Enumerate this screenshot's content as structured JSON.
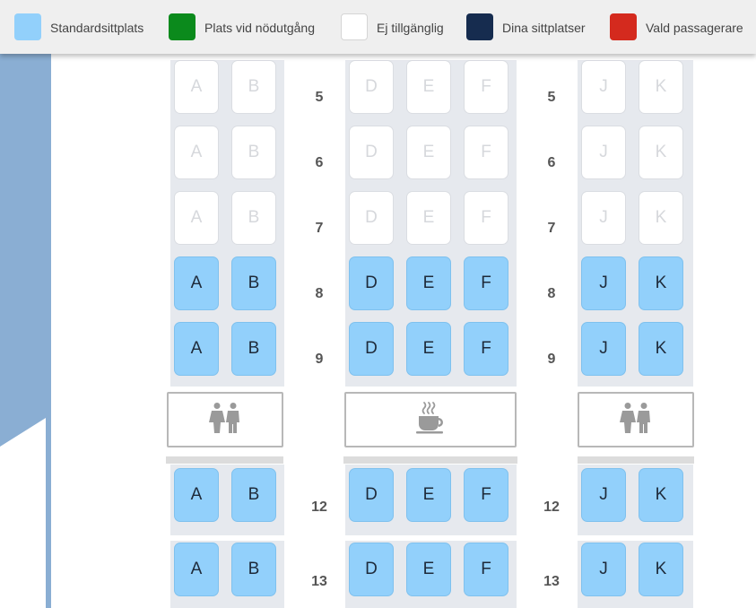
{
  "legend": [
    {
      "name": "legend-standard",
      "label": "Standardsittplats",
      "color": "#92d0fb"
    },
    {
      "name": "legend-emergency",
      "label": "Plats vid nödutgång",
      "color": "#0b8a1c"
    },
    {
      "name": "legend-unavailable",
      "label": "Ej tillgänglig",
      "color": "#ffffff"
    },
    {
      "name": "legend-your-seats",
      "label": "Dina sittplatser",
      "color": "#162c4f"
    },
    {
      "name": "legend-selected",
      "label": "Vald passagerare",
      "color": "#d42a1e"
    }
  ],
  "rows": [
    {
      "number": "5",
      "status": "unavailable"
    },
    {
      "number": "6",
      "status": "unavailable"
    },
    {
      "number": "7",
      "status": "unavailable"
    },
    {
      "number": "8",
      "status": "standard"
    },
    {
      "number": "9",
      "status": "standard"
    },
    {
      "number": "12",
      "status": "standard"
    },
    {
      "number": "13",
      "status": "standard"
    }
  ],
  "seat_letters": {
    "left": [
      "A",
      "B"
    ],
    "middle": [
      "D",
      "E",
      "F"
    ],
    "right": [
      "J",
      "K"
    ]
  },
  "facilities": {
    "left": "lavatory-icon",
    "middle": "coffee-cup-icon",
    "right": "lavatory-icon"
  }
}
